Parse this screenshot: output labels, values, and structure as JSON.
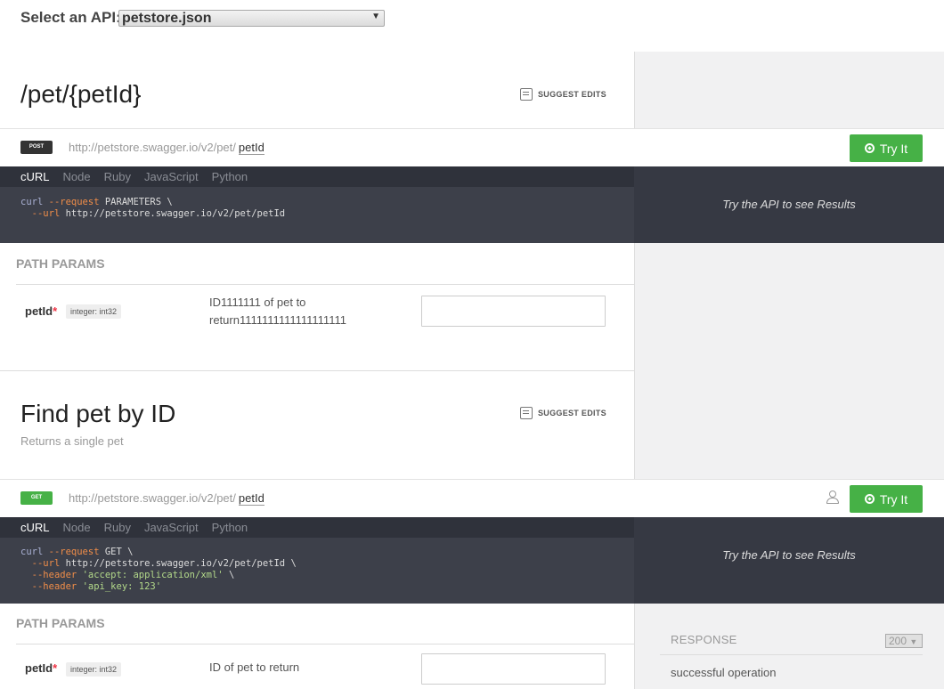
{
  "api_select": {
    "label": "Select an API:",
    "value": "petstore.json"
  },
  "endpoint1": {
    "title": "/pet/{petId}",
    "suggest_edits": "SUGGEST EDITS",
    "method": "POST",
    "method_color": "#333333",
    "url_base": "http://petstore.swagger.io/v2/pet/",
    "url_param": "petId",
    "try_label": "Try It",
    "tabs": [
      "cURL",
      "Node",
      "Ruby",
      "JavaScript",
      "Python"
    ],
    "code": {
      "l1a": "curl",
      "l1b": "--request",
      "l1c": "PARAMETERS \\",
      "l2a": "--url",
      "l2b": "http://petstore.swagger.io/v2/pet/petId"
    },
    "results": "Try the API to see Results",
    "params_title": "PATH PARAMS",
    "param": {
      "name": "petId",
      "required": "*",
      "type": "integer: int32",
      "desc": "ID1111111 of pet to return1111111111111111111"
    }
  },
  "endpoint2": {
    "title": "Find pet by ID",
    "description": "Returns a single pet",
    "suggest_edits": "SUGGEST EDITS",
    "method": "GET",
    "method_color": "#46b146",
    "url_base": "http://petstore.swagger.io/v2/pet/",
    "url_param": "petId",
    "try_label": "Try It",
    "tabs": [
      "cURL",
      "Node",
      "Ruby",
      "JavaScript",
      "Python"
    ],
    "code": {
      "l1a": "curl",
      "l1b": "--request",
      "l1c": "GET \\",
      "l2a": "--url",
      "l2b": "http://petstore.swagger.io/v2/pet/petId \\",
      "l3a": "--header",
      "l3b": "'accept: application/xml'",
      "l3c": "\\",
      "l4a": "--header",
      "l4b": "'api_key: 123'"
    },
    "results": "Try the API to see Results",
    "params_title": "PATH PARAMS",
    "param": {
      "name": "petId",
      "required": "*",
      "type": "integer: int32",
      "desc": "ID of pet to return"
    },
    "response": {
      "label": "RESPONSE",
      "code": "200",
      "desc": "successful operation"
    }
  },
  "colors": {
    "accent_green": "#46b146",
    "code_bg": "#3d404a",
    "tab_bg": "#2f323b",
    "sidebar_bg": "#f1f1f2"
  },
  "icons": [
    "pencil-edit-icon",
    "compass-icon",
    "user-icon",
    "chevron-down-icon"
  ]
}
